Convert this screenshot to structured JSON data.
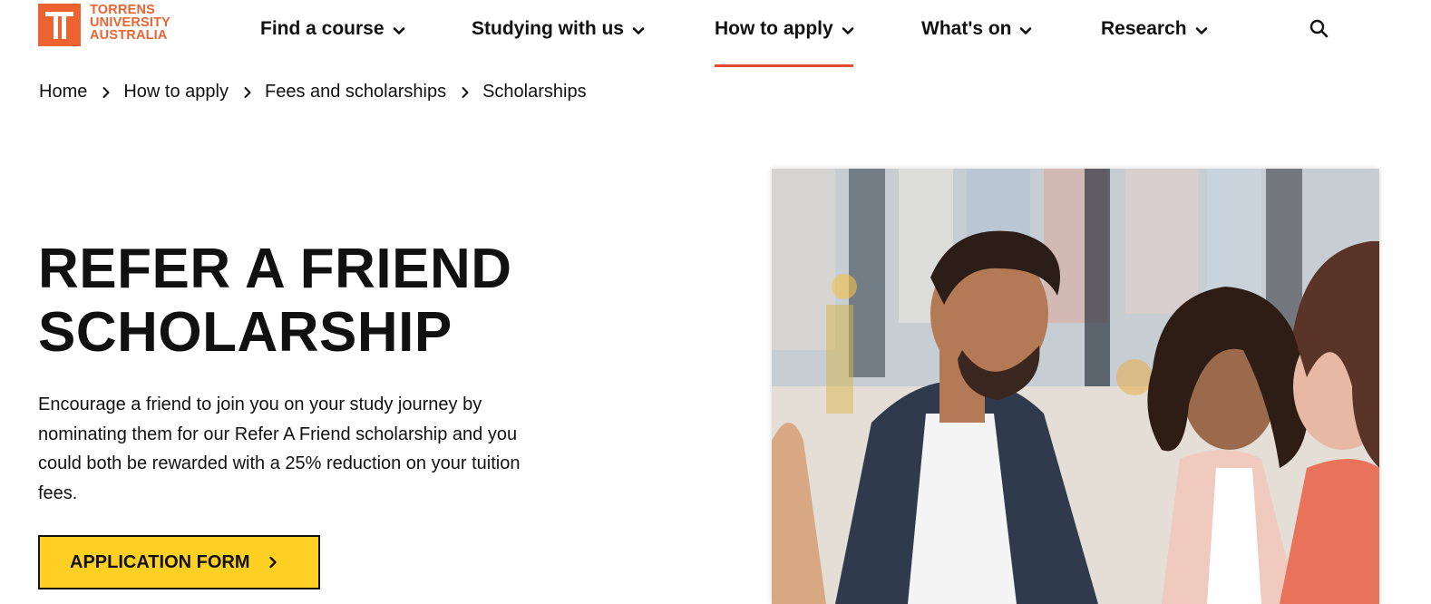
{
  "brand": {
    "name_lines": [
      "TORRENS",
      "UNIVERSITY",
      "AUSTRALIA"
    ],
    "color": "#ec6331"
  },
  "nav": {
    "items": [
      {
        "label": "Find a course"
      },
      {
        "label": "Studying with us"
      },
      {
        "label": "How to apply",
        "active": true
      },
      {
        "label": "What's on"
      },
      {
        "label": "Research"
      }
    ],
    "active_color": "#e34a2f",
    "search_icon": "search-icon"
  },
  "breadcrumb": [
    "Home",
    "How to apply",
    "Fees and scholarships",
    "Scholarships"
  ],
  "hero": {
    "title_lines": [
      "REFER A FRIEND",
      "SCHOLARSHIP"
    ],
    "description_lines": [
      "Encourage a friend to join you on your study journey by",
      "nominating them for our Refer A Friend scholarship and you",
      "could both be rewarded with a 25% reduction on your tuition",
      "fees."
    ],
    "cta_label": "APPLICATION FORM",
    "cta_color": "#ffd024"
  },
  "image": {
    "alt": "Group of smiling students talking outdoors"
  }
}
